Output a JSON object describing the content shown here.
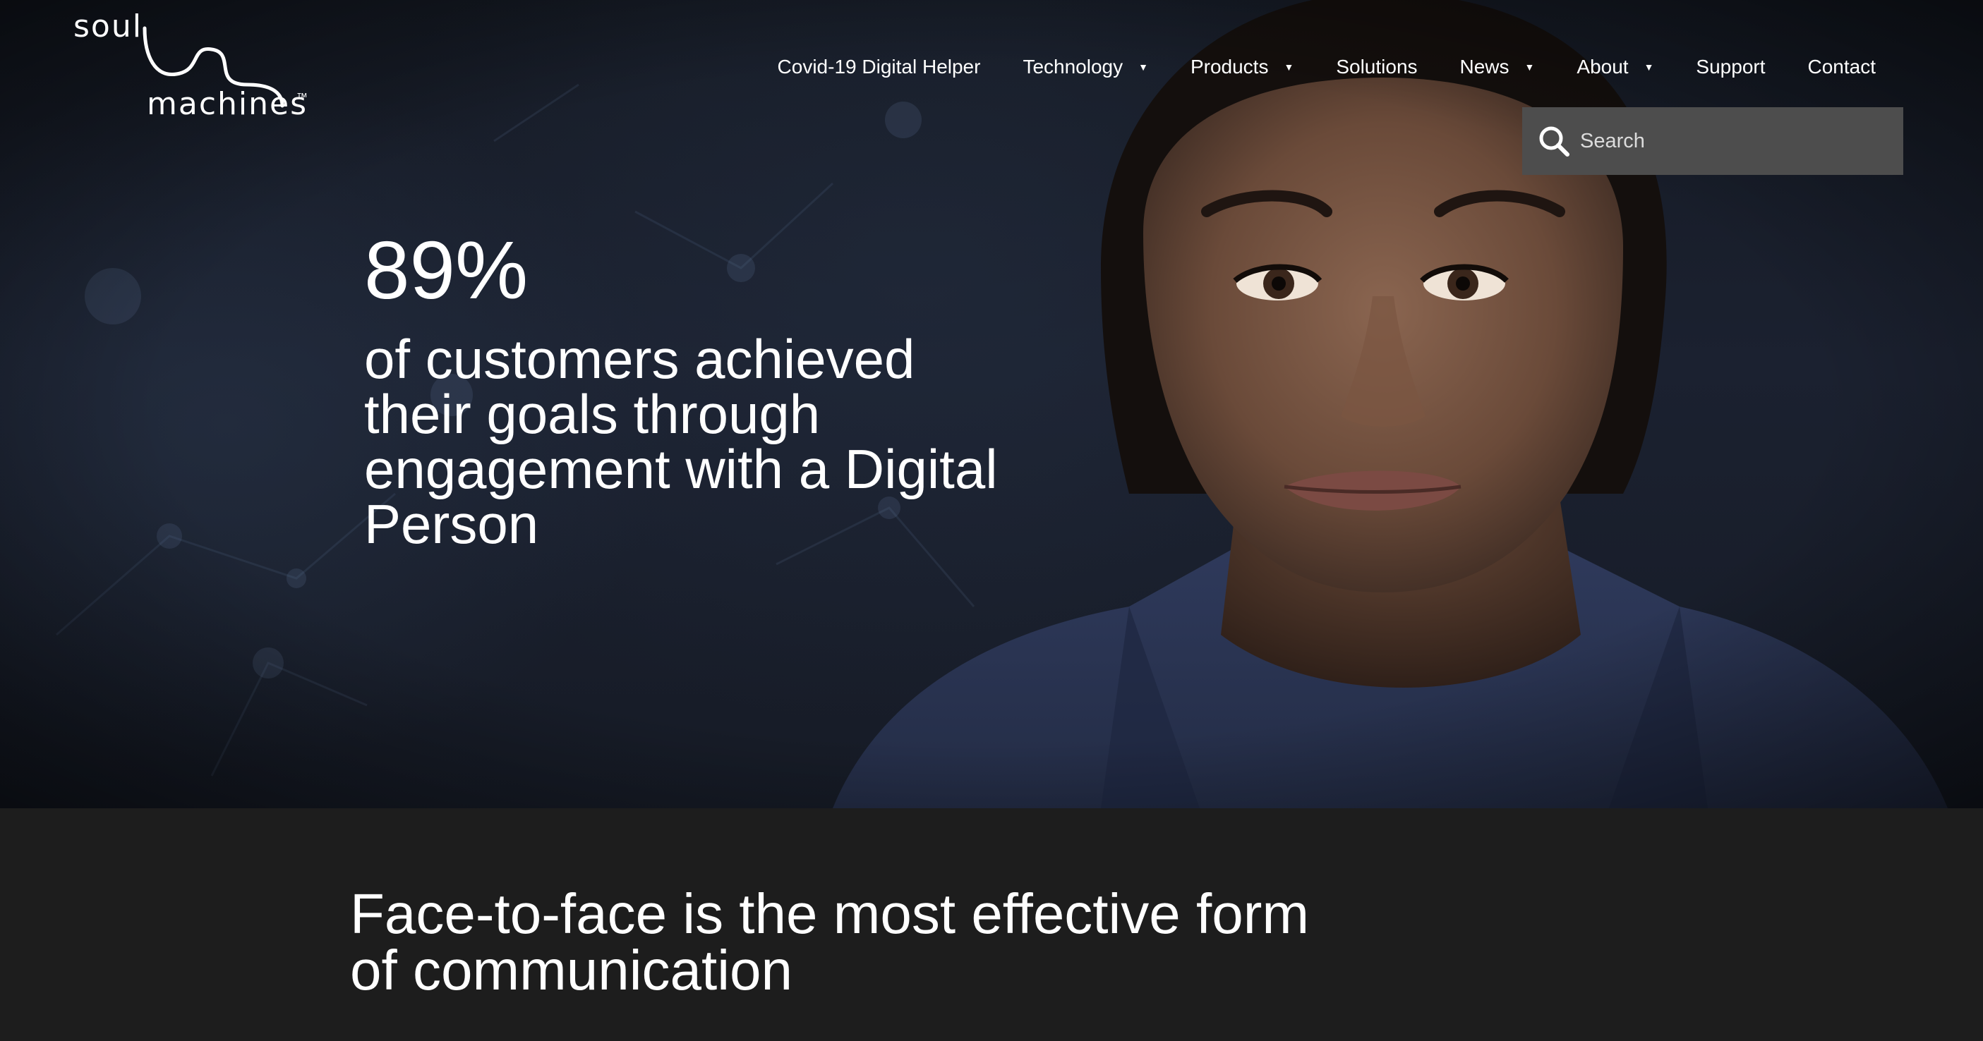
{
  "brand": {
    "logo_line_1": "soul",
    "logo_line_2": "machines",
    "logo_trademark": "™"
  },
  "nav": {
    "items": [
      {
        "label": "Covid-19 Digital Helper",
        "has_dropdown": false
      },
      {
        "label": "Technology",
        "has_dropdown": true
      },
      {
        "label": "Products",
        "has_dropdown": true
      },
      {
        "label": "Solutions",
        "has_dropdown": false
      },
      {
        "label": "News",
        "has_dropdown": true
      },
      {
        "label": "About",
        "has_dropdown": true
      },
      {
        "label": "Support",
        "has_dropdown": false
      },
      {
        "label": "Contact",
        "has_dropdown": false
      }
    ],
    "caret_glyph": "▼"
  },
  "search": {
    "placeholder": "Search",
    "value": "",
    "icon": "search-icon"
  },
  "hero": {
    "stat_value": "89%",
    "stat_description": "of customers achieved their goals through engagement with a Digital Person"
  },
  "section": {
    "heading": "Face-to-face is the most effective form of communication"
  },
  "colors": {
    "hero_background": "#1b2130",
    "section_background": "#1d1d1d",
    "search_background": "#4d4d4d",
    "text": "#ffffff",
    "jacket": "#2b3553"
  }
}
